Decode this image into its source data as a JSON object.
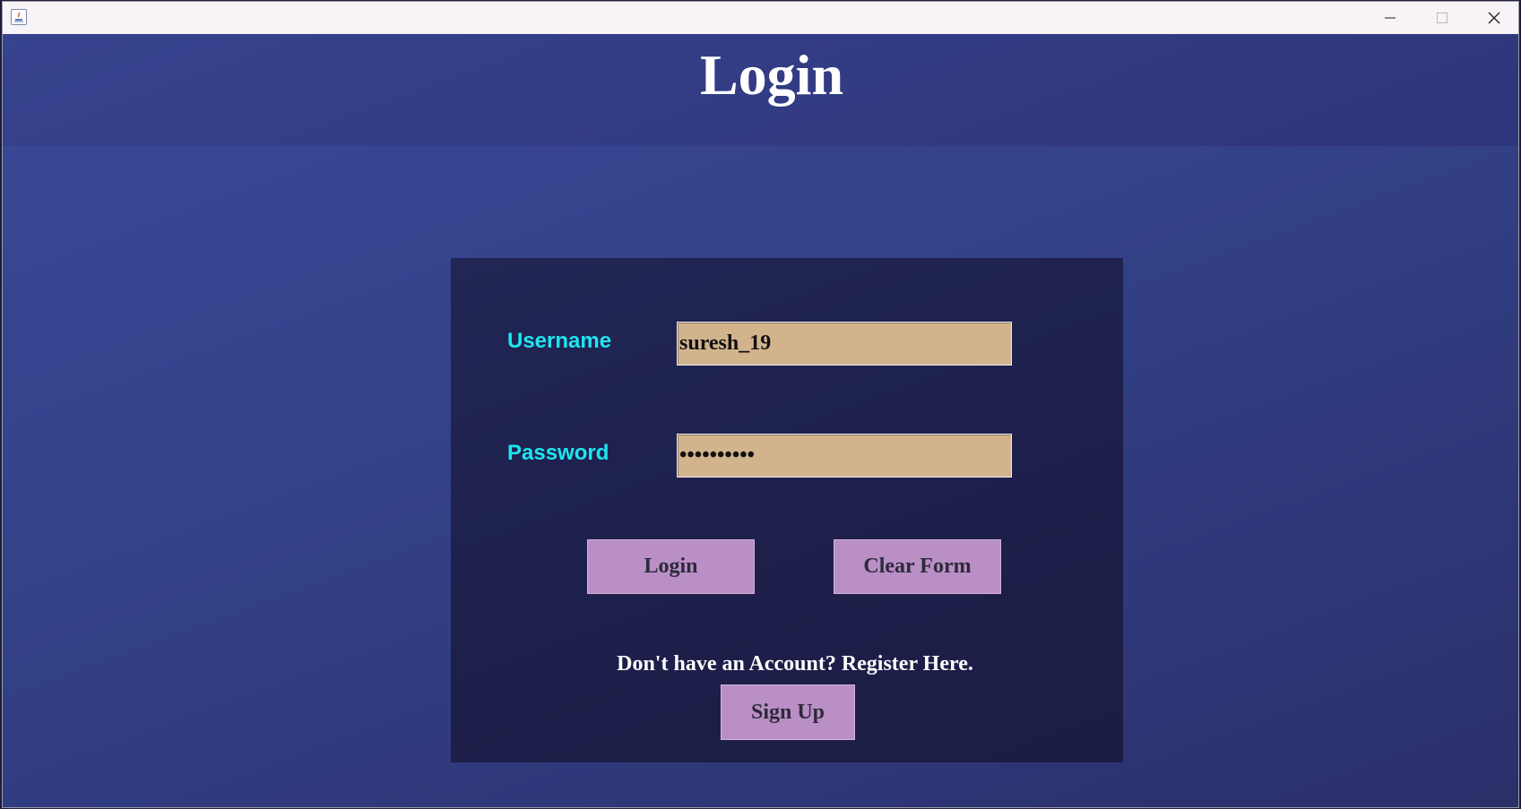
{
  "window": {
    "icon": "java-icon",
    "controls": {
      "minimize": "minimize-icon",
      "maximize": "maximize-icon",
      "close": "close-icon"
    }
  },
  "header": {
    "title": "Login"
  },
  "form": {
    "username": {
      "label": "Username",
      "value": "suresh_19"
    },
    "password": {
      "label": "Password",
      "value": "••••••••••"
    },
    "login_label": "Login",
    "clear_label": "Clear Form",
    "register_text": "Don't have an Account? Register Here.",
    "signup_label": "Sign Up"
  },
  "colors": {
    "background": "#3a4898",
    "card": "#1f2350",
    "label": "#1ee6f0",
    "field": "#d2b48c",
    "button": "#b98fc6"
  }
}
